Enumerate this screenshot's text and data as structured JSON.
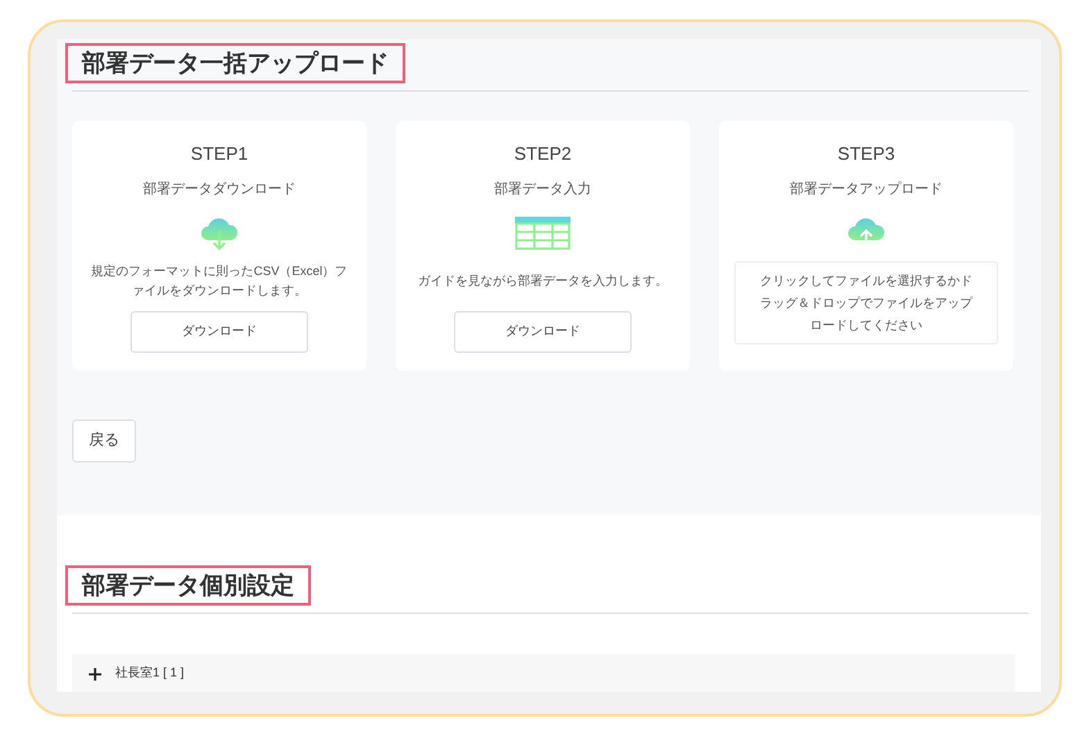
{
  "bulk_upload": {
    "title": "部署データ一括アップロード",
    "steps": [
      {
        "kind": "download",
        "step": "STEP1",
        "title": "部署データダウンロード",
        "description": "規定のフォーマットに則ったCSV（Excel）ファイルをダウンロードします。",
        "button": "ダウンロード"
      },
      {
        "kind": "input",
        "step": "STEP2",
        "title": "部署データ入力",
        "description": "ガイドを見ながら部署データを入力します。",
        "button": "ダウンロード"
      },
      {
        "kind": "upload",
        "step": "STEP3",
        "title": "部署データアップロード",
        "dropzone": "クリックしてファイルを選択するかドラッグ＆ドロップでファイルをアップロードしてください"
      }
    ],
    "back_button": "戻る"
  },
  "individual_settings": {
    "title": "部署データ個別設定",
    "tree": [
      {
        "label": "社長室1 [ 1 ]",
        "expanded": false
      }
    ]
  }
}
